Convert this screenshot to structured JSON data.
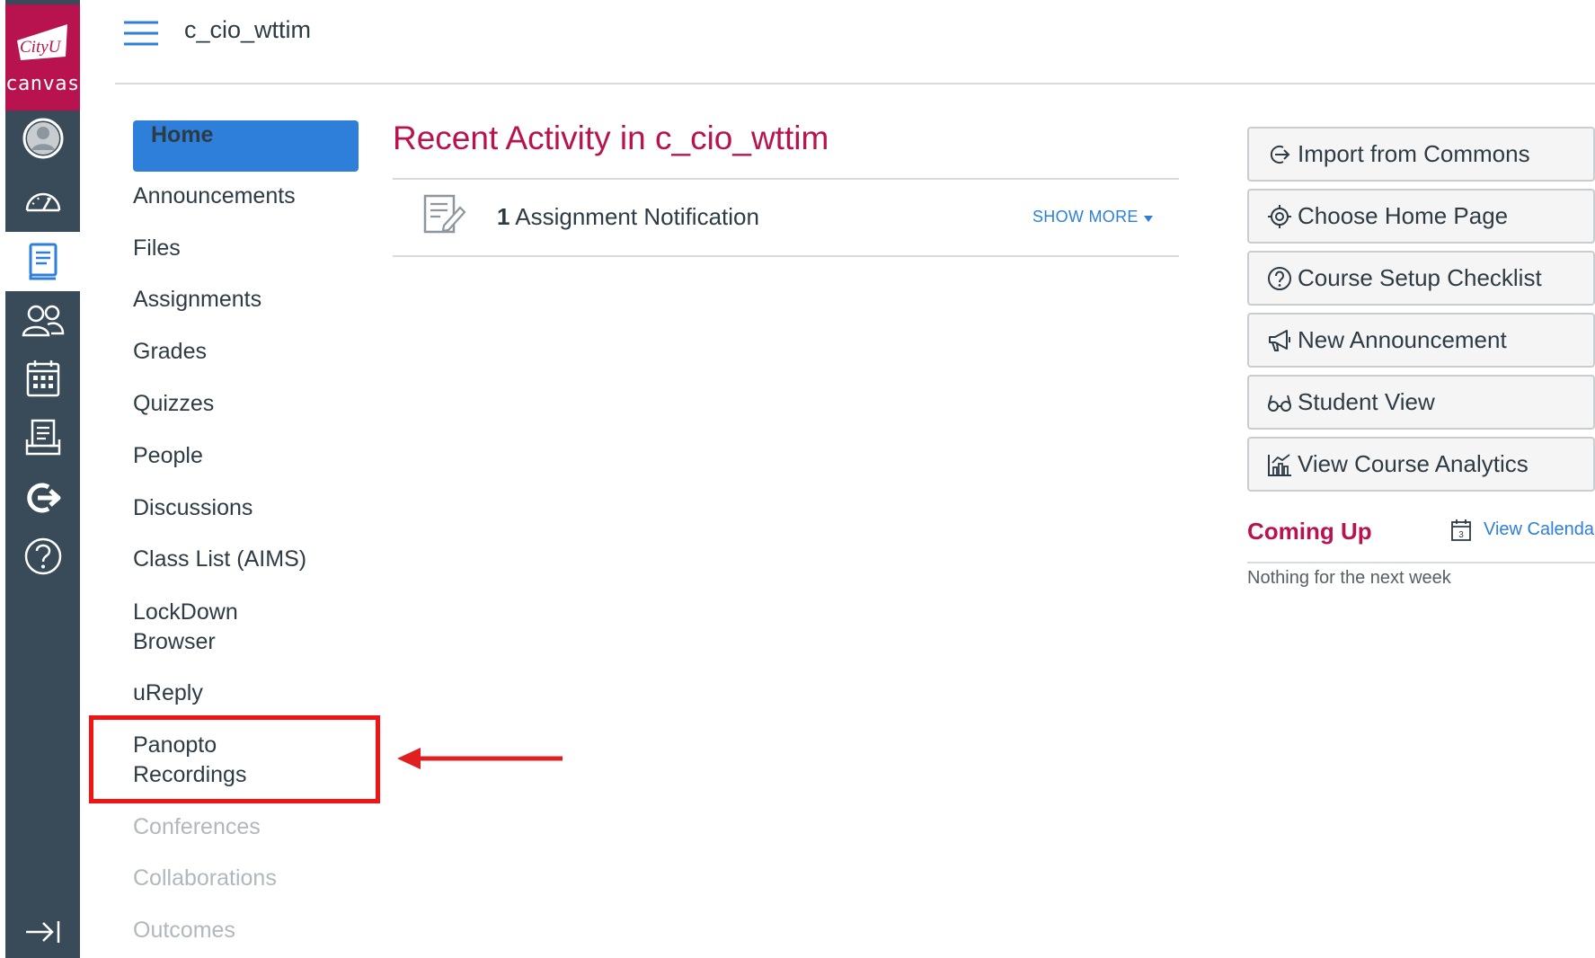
{
  "brand": {
    "logo_text": "CityU",
    "product": "canvas",
    "colors": {
      "rail": "#394b58",
      "brand": "#b8134f",
      "link": "#2d7fd9",
      "highlight": "#f01414"
    }
  },
  "rail_items": [
    {
      "name": "account",
      "icon": "account-icon"
    },
    {
      "name": "dashboard",
      "icon": "dashboard-icon"
    },
    {
      "name": "courses",
      "icon": "courses-icon",
      "active": true
    },
    {
      "name": "groups",
      "icon": "groups-icon"
    },
    {
      "name": "calendar",
      "icon": "calendar-icon"
    },
    {
      "name": "inbox",
      "icon": "inbox-icon"
    },
    {
      "name": "commons",
      "icon": "commons-icon"
    },
    {
      "name": "help",
      "icon": "help-icon"
    },
    {
      "name": "collapse",
      "icon": "collapse-nav-icon"
    }
  ],
  "header": {
    "course_code": "c_cio_wttim"
  },
  "course_nav": [
    {
      "label": "Home",
      "active": true
    },
    {
      "label": "Announcements"
    },
    {
      "label": "Files"
    },
    {
      "label": "Assignments"
    },
    {
      "label": "Grades"
    },
    {
      "label": "Quizzes"
    },
    {
      "label": "People"
    },
    {
      "label": "Discussions"
    },
    {
      "label": "Class List (AIMS)"
    },
    {
      "label_line1": "LockDown",
      "label_line2": "Browser"
    },
    {
      "label": "uReply"
    },
    {
      "label_line1": "Panopto",
      "label_line2": "Recordings",
      "highlighted": true
    },
    {
      "label": "Conferences",
      "hidden": true
    },
    {
      "label": "Collaborations",
      "hidden": true
    },
    {
      "label": "Outcomes",
      "hidden": true
    }
  ],
  "recent_activity": {
    "title": "Recent Activity in c_cio_wttim",
    "items": [
      {
        "count": "1",
        "text": "Assignment Notification",
        "action": "SHOW MORE",
        "icon": "assignment-icon"
      }
    ]
  },
  "sidebar": {
    "buttons": [
      {
        "label": "Import from Commons",
        "icon": "commons-import-icon"
      },
      {
        "label": "Choose Home Page",
        "icon": "target-icon"
      },
      {
        "label": "Course Setup Checklist",
        "icon": "question-icon"
      },
      {
        "label": "New Announcement",
        "icon": "megaphone-icon"
      },
      {
        "label": "Student View",
        "icon": "glasses-icon"
      },
      {
        "label": "View Course Analytics",
        "icon": "analytics-icon"
      }
    ],
    "coming_up": {
      "title": "Coming Up",
      "calendar_day": "3",
      "link": "View Calendar",
      "empty_text": "Nothing for the next week"
    }
  }
}
